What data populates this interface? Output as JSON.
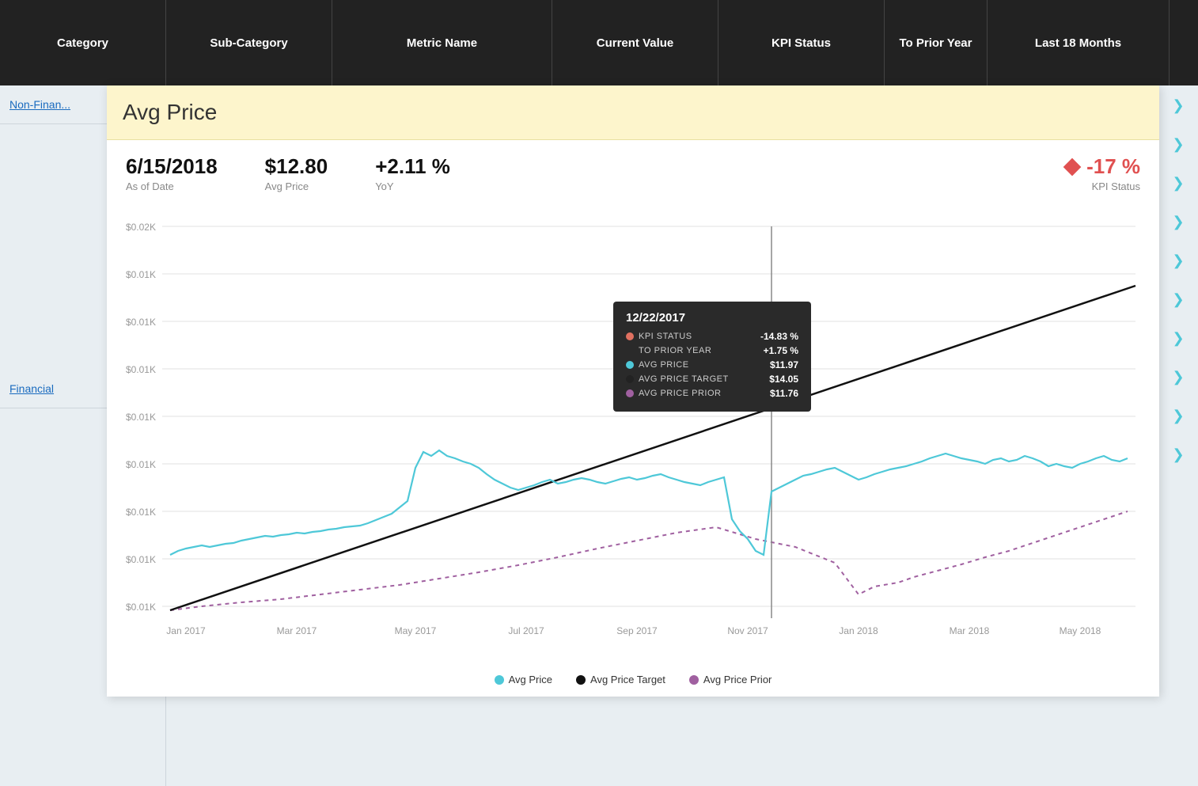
{
  "header": {
    "columns": [
      {
        "id": "category",
        "label": "Category"
      },
      {
        "id": "subcategory",
        "label": "Sub-Category"
      },
      {
        "id": "metric",
        "label": "Metric Name"
      },
      {
        "id": "current",
        "label": "Current Value"
      },
      {
        "id": "kpi",
        "label": "KPI Status"
      },
      {
        "id": "prior",
        "label": "To Prior Year"
      },
      {
        "id": "last18",
        "label": "Last 18 Months"
      }
    ]
  },
  "sidebar": {
    "rows": [
      {
        "label": "Non-Finan...",
        "id": "non-financial"
      },
      {
        "label": "Financial",
        "id": "financial"
      }
    ]
  },
  "panel": {
    "title": "Avg Price",
    "stats": {
      "date": {
        "value": "6/15/2018",
        "label": "As of Date"
      },
      "avg_price": {
        "value": "$12.80",
        "label": "Avg Price"
      },
      "yoy": {
        "value": "+2.11 %",
        "label": "YoY"
      },
      "kpi": {
        "value": "-17 %",
        "label": "KPI Status"
      }
    },
    "chart": {
      "y_labels": [
        "$0.02K",
        "$0.01K",
        "$0.01K",
        "$0.01K",
        "$0.01K",
        "$0.01K",
        "$0.01K",
        "$0.01K",
        "$0.01K"
      ],
      "x_labels": [
        "Jan 2017",
        "Mar 2017",
        "May 2017",
        "Jul 2017",
        "Sep 2017",
        "Nov 2017",
        "Jan 2018",
        "Mar 2018",
        "May 2018"
      ]
    },
    "tooltip": {
      "date": "12/22/2017",
      "rows": [
        {
          "color": "#e07060",
          "label": "KPI STATUS",
          "value": "-14.83 %",
          "type": "circle"
        },
        {
          "color": null,
          "label": "TO PRIOR YEAR",
          "value": "+1.75 %",
          "type": "none"
        },
        {
          "color": "#4ec8d8",
          "label": "AVG PRICE",
          "value": "$11.97",
          "type": "circle"
        },
        {
          "color": "#222",
          "label": "AVG PRICE TARGET",
          "value": "$14.05",
          "type": "circle"
        },
        {
          "color": "#a060a0",
          "label": "AVG PRICE PRIOR",
          "value": "$11.76",
          "type": "circle"
        }
      ]
    },
    "legend": [
      {
        "color": "#4ec8d8",
        "label": "Avg Price",
        "type": "circle"
      },
      {
        "color": "#111",
        "label": "Avg Price Target",
        "type": "circle"
      },
      {
        "color": "#a060a0",
        "label": "Avg Price Prior",
        "type": "circle"
      }
    ]
  },
  "colors": {
    "header_bg": "#222222",
    "panel_title_bg": "#fdf5cc",
    "accent_blue": "#4ec8d8",
    "kpi_red": "#e05050"
  }
}
